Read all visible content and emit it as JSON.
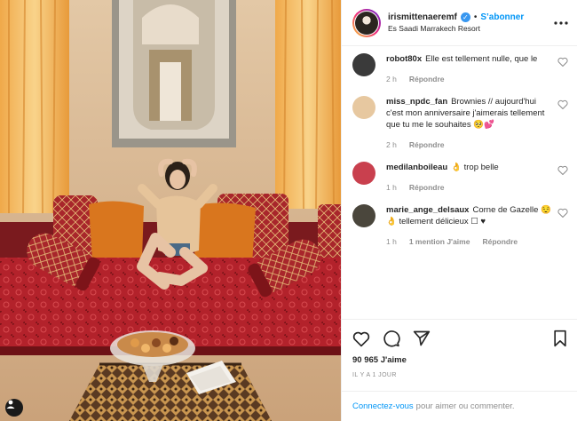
{
  "photo": {
    "alt": ""
  },
  "header": {
    "username": "irismittenaeremf",
    "follow_label": "S’abonner",
    "dot": "•",
    "location": "Es Saadi Marrakech Resort"
  },
  "comments": [
    {
      "username": "robot80x",
      "text": "Elle est tellement nulle, que le",
      "age": "2 h",
      "reply_label": "Répondre",
      "avatar_color": "#3a3a3a"
    },
    {
      "username": "miss_npdc_fan",
      "text": "Brownies // aujourd'hui c'est mon anniversaire j'aimerais tellement que tu me le souhaites 🥺💕",
      "age": "2 h",
      "reply_label": "Répondre",
      "avatar_color": "#e7c8a0"
    },
    {
      "username": "medilanboileau",
      "text": "👌 trop belle",
      "age": "1 h",
      "reply_label": "Répondre",
      "avatar_color": "#c9404e"
    },
    {
      "username": "marie_ange_delsaux",
      "text": "Corne de Gazelle 😌👌 tellement délicieux ☐ ♥",
      "age": "1 h",
      "likes_label": "1 mention J'aime",
      "reply_label": "Répondre",
      "avatar_color": "#4a463c"
    }
  ],
  "actions": {
    "like_icon": "heart-icon",
    "comment_icon": "comment-icon",
    "share_icon": "share-icon",
    "save_icon": "bookmark-icon"
  },
  "likes": "90 965 J'aime",
  "timestamp": "IL Y A 1 JOUR",
  "footer": {
    "login_label": "Connectez-vous",
    "text": "pour aimer ou commenter."
  }
}
